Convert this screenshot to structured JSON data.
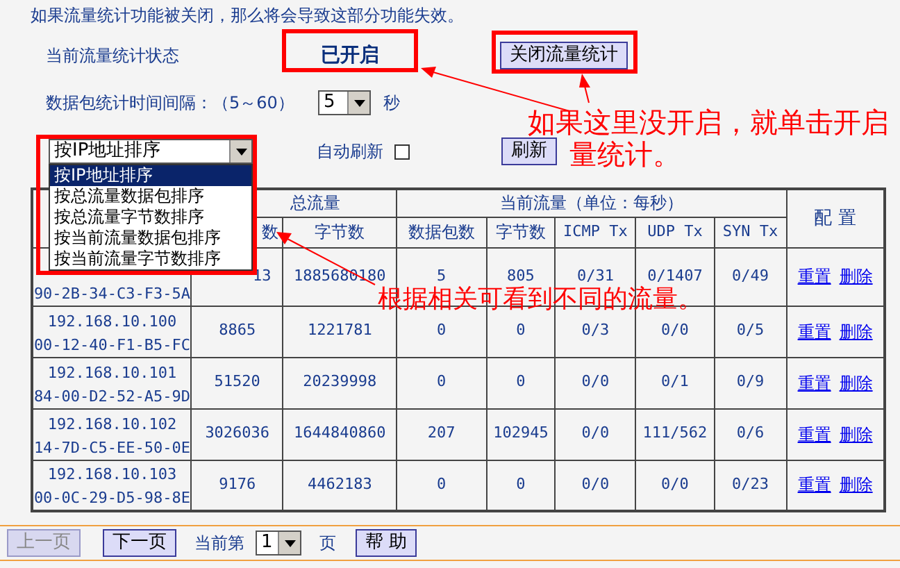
{
  "notice": "如果流量统计功能被关闭，那么将会导致这部分功能失效。",
  "status": {
    "label": "当前流量统计状态",
    "value": "已开启",
    "button": "关闭流量统计"
  },
  "interval": {
    "label": "数据包统计时间间隔：（5～60）",
    "value": "5",
    "unit": "秒"
  },
  "sort": {
    "value": "按IP地址排序",
    "expanded": true,
    "options": [
      {
        "label": "按IP地址排序",
        "selected": true
      },
      {
        "label": "按总流量数据包排序",
        "selected": false
      },
      {
        "label": "按总流量字节数排序",
        "selected": false
      },
      {
        "label": "按当前流量数据包排序",
        "selected": false
      },
      {
        "label": "按当前流量字节数排序",
        "selected": false
      }
    ]
  },
  "auto_refresh": {
    "label": "自动刷新",
    "checked": false
  },
  "refresh_button": "刷新",
  "table": {
    "header_groups": [
      "总流量",
      "当前流量（单位：每秒）"
    ],
    "config_header": "配 置",
    "columns": [
      "数",
      "字节数",
      "数据包数",
      "字节数",
      "ICMP Tx",
      "UDP Tx",
      "SYN Tx"
    ],
    "rows": [
      {
        "mac": "90-2B-34-C3-F3-5A",
        "cells": [
          "13",
          "1885680180",
          "5",
          "805",
          "0/31",
          "0/1407",
          "0/49"
        ],
        "actions": [
          "重置",
          "删除"
        ]
      },
      {
        "ip": "192.168.10.100",
        "mac": "00-12-40-F1-B5-FC",
        "cells": [
          "8865",
          "1221781",
          "0",
          "0",
          "0/3",
          "0/0",
          "0/5"
        ],
        "actions": [
          "重置",
          "删除"
        ]
      },
      {
        "ip": "192.168.10.101",
        "mac": "84-00-D2-52-A5-9D",
        "cells": [
          "51520",
          "20239998",
          "0",
          "0",
          "0/0",
          "0/1",
          "0/9"
        ],
        "actions": [
          "重置",
          "删除"
        ]
      },
      {
        "ip": "192.168.10.102",
        "mac": "14-7D-C5-EE-50-0E",
        "cells": [
          "3026036",
          "1644840860",
          "207",
          "102945",
          "0/0",
          "111/562",
          "0/6"
        ],
        "actions": [
          "重置",
          "删除"
        ]
      },
      {
        "ip": "192.168.10.103",
        "mac": "00-0C-29-D5-98-8E",
        "cells": [
          "9176",
          "4462183",
          "0",
          "0",
          "0/0",
          "0/0",
          "0/23"
        ],
        "actions": [
          "重置",
          "删除"
        ]
      }
    ]
  },
  "pagination": {
    "prev": {
      "label": "上一页",
      "disabled": true
    },
    "next": {
      "label": "下一页",
      "disabled": false
    },
    "current_label": "当前第",
    "page": "1",
    "page_unit": "页",
    "help": "帮 助"
  },
  "annotations": [
    {
      "text": "如果这里没开启，就单击开启"
    },
    {
      "text": "量统计。"
    },
    {
      "text": "根据相关可看到不同的流量。"
    }
  ]
}
